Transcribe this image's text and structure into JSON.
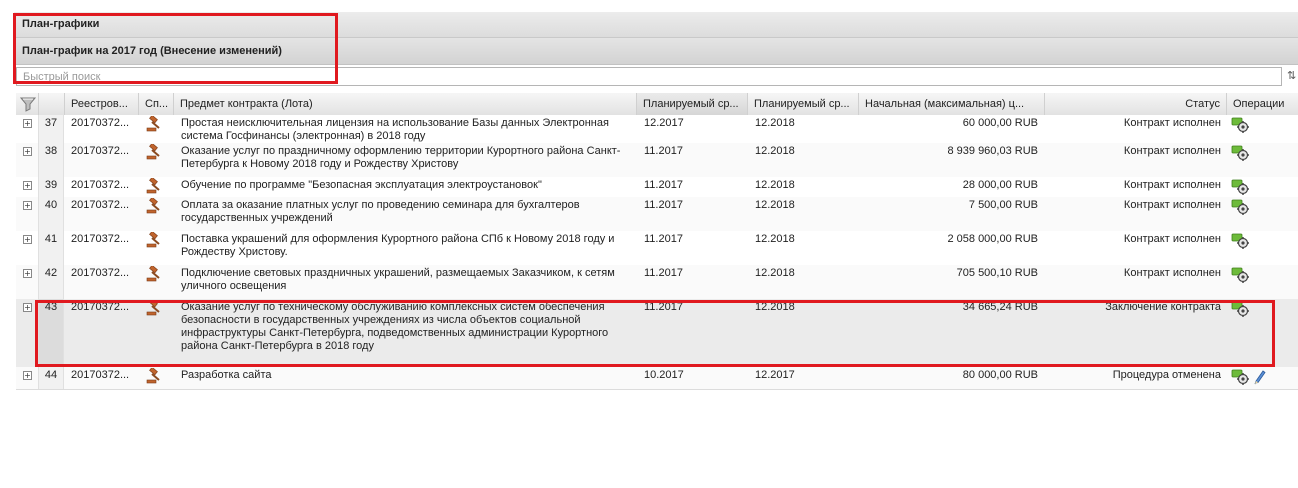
{
  "panel": {
    "title": "План-графики"
  },
  "plan": {
    "title": "План-график на 2017 год (Внесение изменений)"
  },
  "search": {
    "placeholder": "Быстрый поиск",
    "button_glyph": "⇅"
  },
  "columns": {
    "registry": "Реестров...",
    "method": "Сп...",
    "subject": "Предмет контракта (Лота)",
    "planned_start": "Планируемый ср...",
    "planned_end": "Планируемый ср...",
    "price": "Начальная (максимальная) ц...",
    "status": "Статус",
    "operations": "Операции"
  },
  "icons": {
    "filter": "filter-icon",
    "expand": "expand-plus-icon",
    "gavel": "gavel-icon",
    "gear": "gear-icon",
    "edit": "pencil-icon"
  },
  "colors": {
    "highlight": "#e0191f",
    "gavel": "#c0642d",
    "gear_green": "#4fa72a"
  },
  "rows": [
    {
      "num": "37",
      "registry": "20170372...",
      "subject": "Простая неисключительная лицензия на использование Базы данных Электронная система Госфинансы (электронная) в 2018 году",
      "planned_start": "12.2017",
      "planned_end": "12.2018",
      "price": "60 000,00 RUB",
      "status": "Контракт исполнен",
      "edit": false
    },
    {
      "num": "38",
      "registry": "20170372...",
      "subject": "Оказание услуг по праздничному оформлению территории Курортного района Санкт-Петербурга к Новому 2018 году и Рождеству Христову",
      "planned_start": "11.2017",
      "planned_end": "12.2018",
      "price": "8 939 960,03 RUB",
      "status": "Контракт исполнен",
      "edit": false
    },
    {
      "num": "39",
      "registry": "20170372...",
      "subject": "Обучение по программе \"Безопасная эксплуатация электроустановок\"",
      "planned_start": "11.2017",
      "planned_end": "12.2018",
      "price": "28 000,00 RUB",
      "status": "Контракт исполнен",
      "edit": false
    },
    {
      "num": "40",
      "registry": "20170372...",
      "subject": "Оплата за оказание платных услуг по проведению семинара для бухгалтеров государственных учреждений",
      "planned_start": "11.2017",
      "planned_end": "12.2018",
      "price": "7 500,00 RUB",
      "status": "Контракт исполнен",
      "edit": false
    },
    {
      "num": "41",
      "registry": "20170372...",
      "subject": "Поставка украшений для оформления Курортного района СПб к Новому 2018 году и Рождеству Христову.",
      "planned_start": "11.2017",
      "planned_end": "12.2018",
      "price": "2 058 000,00 RUB",
      "status": "Контракт исполнен",
      "edit": false
    },
    {
      "num": "42",
      "registry": "20170372...",
      "subject": "Подключение световых праздничных украшений, размещаемых Заказчиком, к сетям уличного освещения",
      "planned_start": "11.2017",
      "planned_end": "12.2018",
      "price": "705 500,10 RUB",
      "status": "Контракт исполнен",
      "edit": false
    },
    {
      "num": "43",
      "registry": "20170372...",
      "subject": "Оказание услуг по техническому обслуживанию комплексных систем обеспечения безопасности в государственных учреждениях из числа объектов социальной инфраструктуры Санкт-Петербурга, подведомственных администрации Курортного района Санкт-Петербурга в 2018 году",
      "planned_start": "11.2017",
      "planned_end": "12.2018",
      "price": "34 665,24 RUB",
      "status": "Заключение контракта",
      "edit": false
    },
    {
      "num": "44",
      "registry": "20170372...",
      "subject": "Разработка сайта",
      "planned_start": "10.2017",
      "planned_end": "12.2017",
      "price": "80 000,00 RUB",
      "status": "Процедура отменена",
      "edit": true
    }
  ]
}
